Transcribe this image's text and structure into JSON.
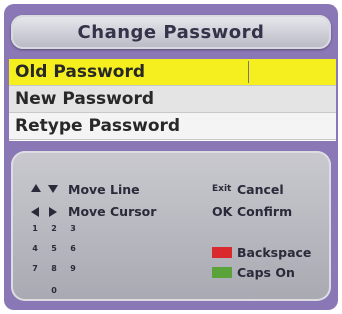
{
  "title": "Change Password",
  "fields": [
    {
      "label": "Old Password"
    },
    {
      "label": "New Password"
    },
    {
      "label": "Retype Password"
    }
  ],
  "help": {
    "move_line": "Move Line",
    "move_cursor": "Move Cursor",
    "exit_key": "Exit",
    "cancel": "Cancel",
    "ok_key": "OK",
    "confirm": "Confirm",
    "backspace": "Backspace",
    "caps_on": "Caps On",
    "numkeys": [
      "1",
      "2",
      "3",
      "4",
      "5",
      "6",
      "7",
      "8",
      "9",
      "0"
    ]
  },
  "colors": {
    "selected_row": "#f6ef1f",
    "backspace_key": "#d9282e",
    "caps_key": "#5aa23a"
  }
}
